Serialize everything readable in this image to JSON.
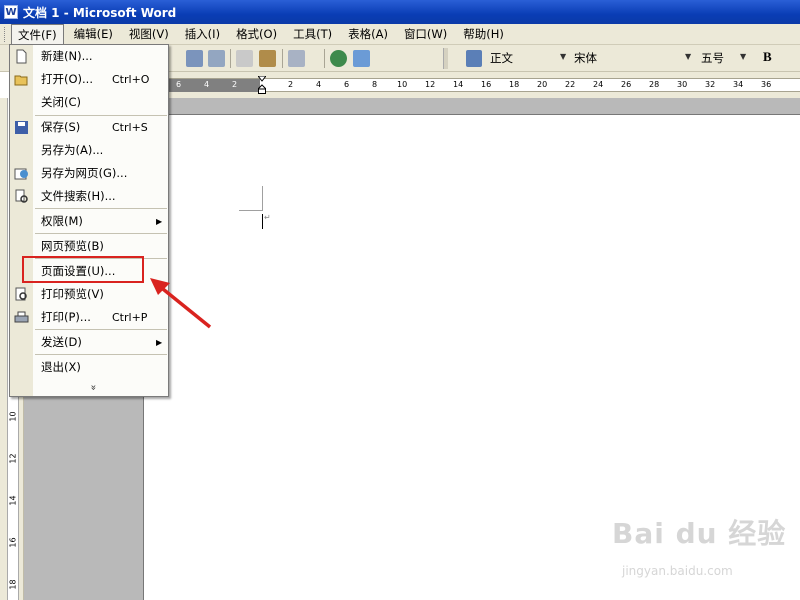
{
  "window": {
    "title": "文档 1 - Microsoft Word",
    "app_icon": "W"
  },
  "menubar": {
    "items": [
      "文件(F)",
      "编辑(E)",
      "视图(V)",
      "插入(I)",
      "格式(O)",
      "工具(T)",
      "表格(A)",
      "窗口(W)",
      "帮助(H)"
    ]
  },
  "toolbar": {
    "style": "正文",
    "font": "宋体",
    "size": "五号",
    "bold": "B"
  },
  "ruler": {
    "labels": [
      "6",
      "4",
      "2",
      "2",
      "4",
      "6",
      "8",
      "10",
      "12",
      "14",
      "16",
      "18",
      "20",
      "22",
      "24",
      "26",
      "28",
      "30",
      "32",
      "34",
      "36"
    ],
    "left_labels": [
      "10",
      "12",
      "14",
      "16",
      "18"
    ]
  },
  "file_menu": {
    "items": [
      {
        "label": "新建(N)...",
        "shortcut": "",
        "icon": "new-doc-icon"
      },
      {
        "label": "打开(O)...",
        "shortcut": "Ctrl+O",
        "icon": "open-folder-icon"
      },
      {
        "label": "关闭(C)",
        "shortcut": "",
        "icon": ""
      },
      {
        "label": "保存(S)",
        "shortcut": "Ctrl+S",
        "icon": "save-disk-icon"
      },
      {
        "label": "另存为(A)...",
        "shortcut": "",
        "icon": ""
      },
      {
        "label": "另存为网页(G)...",
        "shortcut": "",
        "icon": "web-page-icon"
      },
      {
        "label": "文件搜索(H)...",
        "shortcut": "",
        "icon": "file-search-icon"
      },
      {
        "label": "权限(M)",
        "shortcut": "",
        "icon": ""
      },
      {
        "label": "网页预览(B)",
        "shortcut": "",
        "icon": ""
      },
      {
        "label": "页面设置(U)...",
        "shortcut": "",
        "icon": ""
      },
      {
        "label": "打印预览(V)",
        "shortcut": "",
        "icon": "print-preview-icon"
      },
      {
        "label": "打印(P)...",
        "shortcut": "Ctrl+P",
        "icon": "printer-icon"
      },
      {
        "label": "发送(D)",
        "shortcut": "",
        "icon": ""
      },
      {
        "label": "退出(X)",
        "shortcut": "",
        "icon": ""
      }
    ],
    "expand_glyph": "»"
  },
  "watermark": {
    "main": "Bai du 经验",
    "sub": "jingyan.baidu.com"
  },
  "colors": {
    "titlebar": "#0a3db5",
    "highlight": "#d9231f",
    "menu_bg": "#ece9d8"
  }
}
